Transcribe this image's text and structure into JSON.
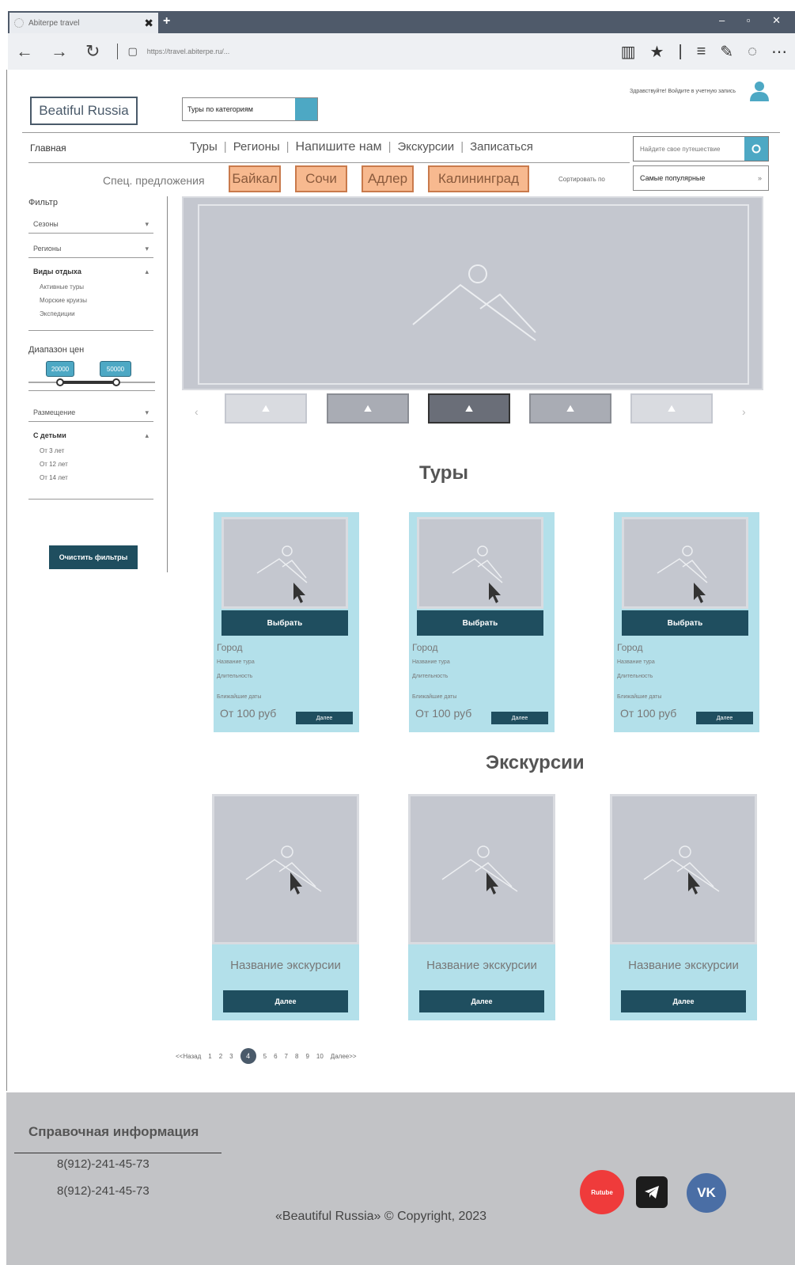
{
  "browser": {
    "tab_title": "Abiterpe travel",
    "tab_close": "✖",
    "new_tab": "+",
    "window_controls": "– ▫ ✕",
    "url": "https://travel.abiterpe.ru/..."
  },
  "header": {
    "logo": "Beatiful Russia",
    "category_select": "Туры по категориям",
    "greeting": "Здравствуйте! Войдите в учетную запись"
  },
  "nav": {
    "home": "Главная",
    "links": [
      "Туры",
      "Регионы",
      "Напишите нам",
      "Экскурсии",
      "Записаться"
    ],
    "search_placeholder": "Найдите свое путешествие"
  },
  "offers": {
    "label": "Спец. предложения",
    "chips": [
      "Байкал",
      "Сочи",
      "Адлер",
      "Калининград"
    ],
    "sort_label": "Сортировать по",
    "sort_value": "Самые популярные",
    "sort_arrow": "»"
  },
  "filter": {
    "title": "Фильтр",
    "seasons": "Сезоны",
    "regions": "Регионы",
    "rest_types": {
      "title": "Виды отдыха",
      "items": [
        "Активные туры",
        "Морские круизы",
        "Экспедиции"
      ]
    },
    "price_title": "Диапазон цен",
    "price_min": "20000",
    "price_max": "50000",
    "placement": "Размещение",
    "kids": {
      "title": "С детьми",
      "items": [
        "От 3 лет",
        "От 12 лет",
        "От 14 лет"
      ]
    },
    "clear_button": "Очистить фильтры"
  },
  "carousel": {
    "prev": "‹",
    "next": "›",
    "thumbs": 5,
    "active_thumb": 2
  },
  "tours": {
    "title": "Туры",
    "cards": [
      {
        "choose": "Выбрать",
        "city": "Город",
        "name": "Название тура",
        "length": "Длительность",
        "nearest": "Ближайшие даты",
        "price": "От 100 руб",
        "more": "Далее"
      },
      {
        "choose": "Выбрать",
        "city": "Город",
        "name": "Название тура",
        "length": "Длительность",
        "nearest": "Ближайшие даты",
        "price": "От 100 руб",
        "more": "Далее"
      },
      {
        "choose": "Выбрать",
        "city": "Город",
        "name": "Название тура",
        "length": "Длительность",
        "nearest": "Ближайшие даты",
        "price": "От 100 руб",
        "more": "Далее"
      }
    ]
  },
  "excursions": {
    "title": "Экскурсии",
    "cards": [
      {
        "name": "Название экскурсии",
        "more": "Далее"
      },
      {
        "name": "Название экскурсии",
        "more": "Далее"
      },
      {
        "name": "Название экскурсии",
        "more": "Далее"
      }
    ]
  },
  "pager": {
    "prev": "<<Назад",
    "pages": [
      "1",
      "2",
      "3",
      "4",
      "5",
      "6",
      "7",
      "8",
      "9",
      "10"
    ],
    "current": "4",
    "next": "Далее>>"
  },
  "footer": {
    "title": "Справочная информация",
    "phone1": "8(912)-241-45-73",
    "phone2": "8(912)-241-45-73",
    "copyright": "«Beautiful Russia» © Copyright, 2023",
    "social": {
      "rutube": "Rutube",
      "telegram": "telegram-icon",
      "vk": "VK"
    },
    "colors": {
      "rutube": "#ef3b3b",
      "telegram": "#1c1c1c",
      "vk": "#4a6ea5"
    }
  },
  "colors": {
    "accent": "#4da8c4",
    "dark_button": "#1f4e5f",
    "card_bg": "#b3e0ea",
    "chip_bg": "#f7b98f",
    "placeholder": "#c4c7cf",
    "footer_bg": "#c2c3c6"
  }
}
